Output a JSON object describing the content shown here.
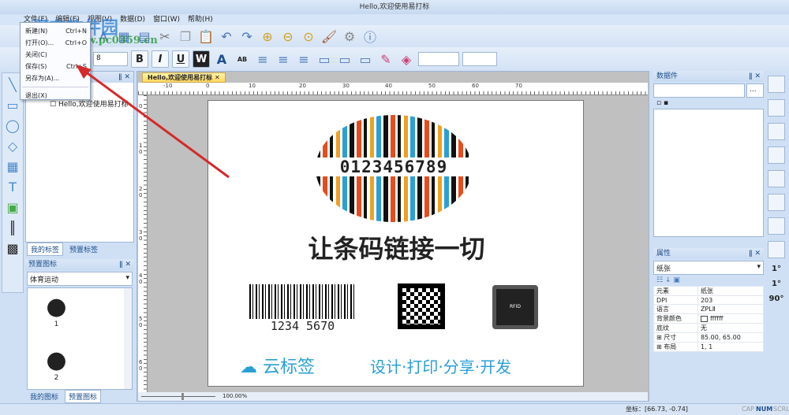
{
  "window": {
    "title": "Hello,欢迎使用易打标"
  },
  "menubar": [
    "文件(F)",
    "编辑(E)",
    "视图(V)",
    "数据(D)",
    "窗口(W)",
    "帮助(H)"
  ],
  "file_menu": [
    {
      "label": "新建(N)",
      "shortcut": "Ctrl+N"
    },
    {
      "label": "打开(O)...",
      "shortcut": "Ctrl+O"
    },
    {
      "label": "关闭(C)",
      "shortcut": ""
    },
    {
      "label": "保存(S)",
      "shortcut": "Ctrl+S"
    },
    {
      "label": "另存为(A)...",
      "shortcut": ""
    },
    {
      "label": "退出(X)",
      "shortcut": ""
    }
  ],
  "watermark": {
    "name": "河东软件园",
    "url": "www.pc0359.cn"
  },
  "toolbar": {
    "font_size": "8",
    "bold": "B",
    "italic": "I",
    "underline": "U",
    "wordart": "W",
    "font_color": "A",
    "highlight": "AB"
  },
  "left_panel": {
    "tree_item": "Hello,欢迎使用易打标",
    "tabs": [
      "我的标签",
      "预置标签"
    ],
    "icons_title": "预置图标",
    "category": "体育运动",
    "icon_items": [
      "1",
      "2"
    ],
    "bottom_tabs": [
      "我的图标",
      "预置图标"
    ]
  },
  "document": {
    "tab": "Hello,欢迎使用易打标",
    "ruler_h": [
      "-10",
      "0",
      "10",
      "20",
      "30",
      "40",
      "50",
      "60",
      "70"
    ],
    "ruler_v": [
      "0",
      "1 0",
      "2 0",
      "3 0",
      "4 0",
      "5 0",
      "6 0"
    ],
    "zoom": "100.00%"
  },
  "label": {
    "barcode_digits": "0123456789",
    "slogan": "让条码链接一切",
    "small_barcode": "1234  5670",
    "brand": "云标签",
    "tagline": "设计·打印·分享·开发",
    "rfid": "RFID"
  },
  "data_panel": {
    "title": "数据件",
    "browse": "..."
  },
  "props": {
    "title": "属性",
    "object": "纸张",
    "rows": [
      [
        "元素",
        "纸张"
      ],
      [
        "DPI",
        "203"
      ],
      [
        "语言",
        "ZPLⅡ"
      ],
      [
        "背景颜色",
        "ffffff"
      ],
      [
        "底纹",
        "无"
      ],
      [
        "⊞ 尺寸",
        "85.00, 65.00"
      ],
      [
        "⊞ 布局",
        "1, 1"
      ]
    ]
  },
  "rotate": [
    "1°",
    "1°",
    "90°"
  ],
  "status": {
    "coords": "坐标：[66.73, -0.74]",
    "cap": "CAP",
    "num": "NUM",
    "scrl": "SCRL"
  },
  "colors": {
    "accent": "#1e4f8c",
    "brand": "#2a9fd6"
  }
}
